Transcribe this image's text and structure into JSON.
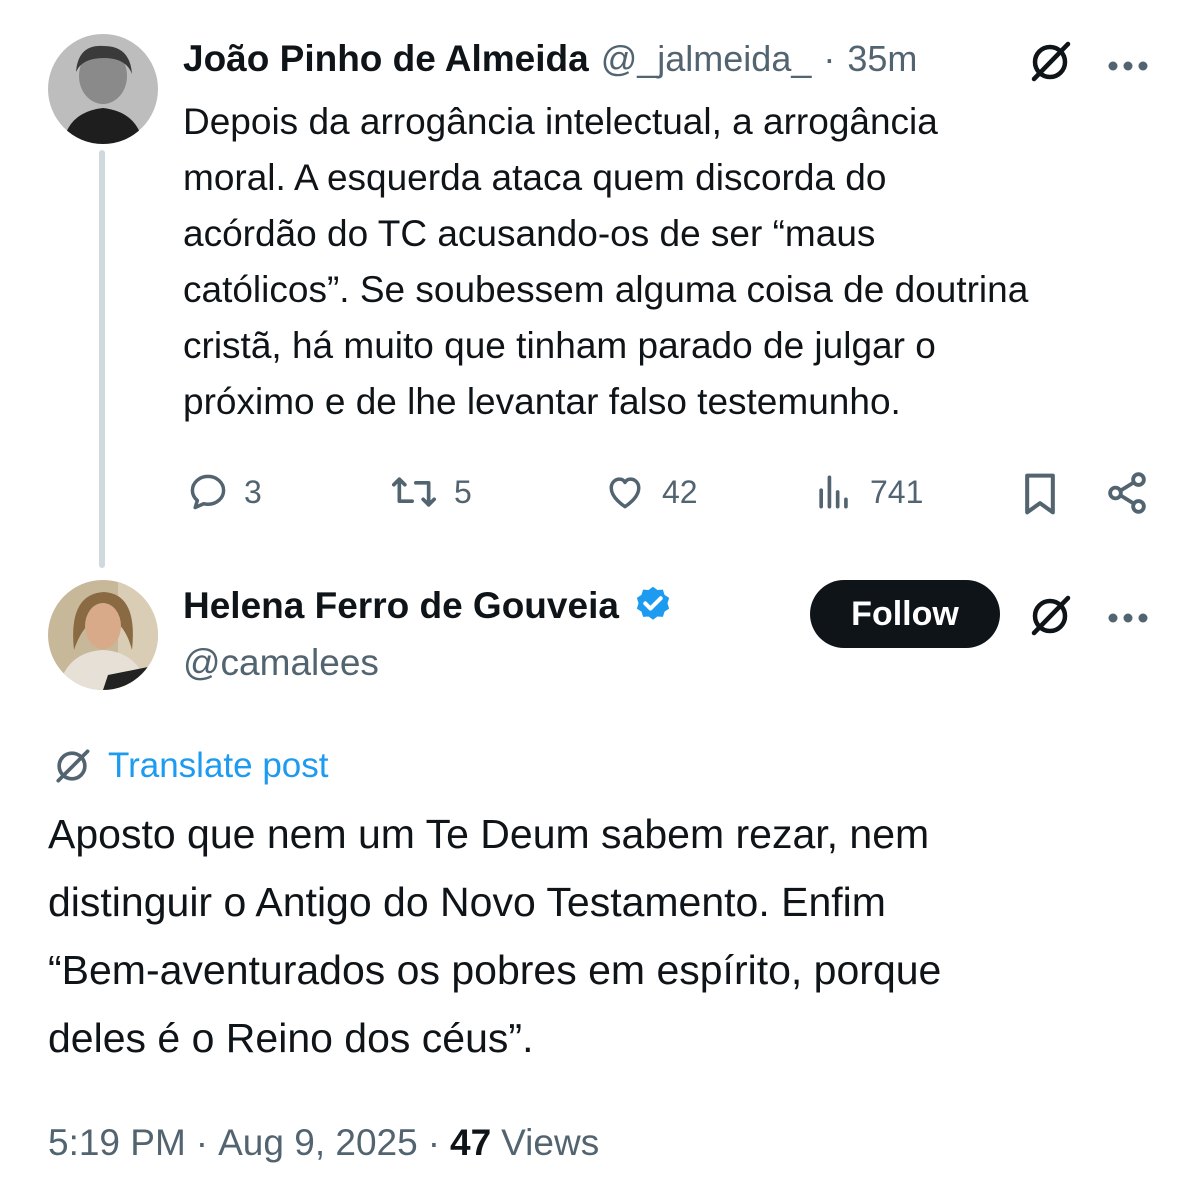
{
  "parent_tweet": {
    "author_name": "João Pinho de Almeida",
    "handle": "@_jalmeida_",
    "separator": "·",
    "time": "35m",
    "text_lines": [
      "Depois da arrogância intelectual, a arrogância",
      "moral. A esquerda ataca quem discorda do",
      "acórdão do TC acusando-os de ser “maus",
      "católicos”. Se soubessem alguma coisa de doutrina",
      "cristã, há muito que tinham parado de julgar o",
      "próximo e de lhe levantar falso testemunho."
    ],
    "actions": {
      "replies": "3",
      "reposts": "5",
      "likes": "42",
      "views": "741"
    }
  },
  "main_tweet": {
    "author_name": "Helena Ferro de Gouveia",
    "handle": "@camalees",
    "follow_label": "Follow",
    "translate_label": "Translate post",
    "text_lines": [
      "Aposto que nem um Te Deum sabem rezar, nem",
      "distinguir o Antigo do Novo Testamento. Enfim",
      "“Bem-aventurados os pobres em espírito, porque",
      "deles é o Reino dos céus”."
    ],
    "meta": {
      "time": "5:19 PM",
      "sep1": "·",
      "date": "Aug 9, 2025",
      "sep2": "·",
      "views_count": "47",
      "views_label": "Views"
    }
  },
  "colors": {
    "text": "#0f1419",
    "muted": "#536471",
    "link": "#1d9bf0",
    "verified": "#1d9bf0",
    "thread_line": "#cfd9de"
  },
  "icons": [
    "grok-icon",
    "more-icon",
    "reply-icon",
    "repost-icon",
    "like-icon",
    "views-icon",
    "bookmark-icon",
    "share-icon",
    "verified-badge-icon",
    "translate-icon"
  ]
}
